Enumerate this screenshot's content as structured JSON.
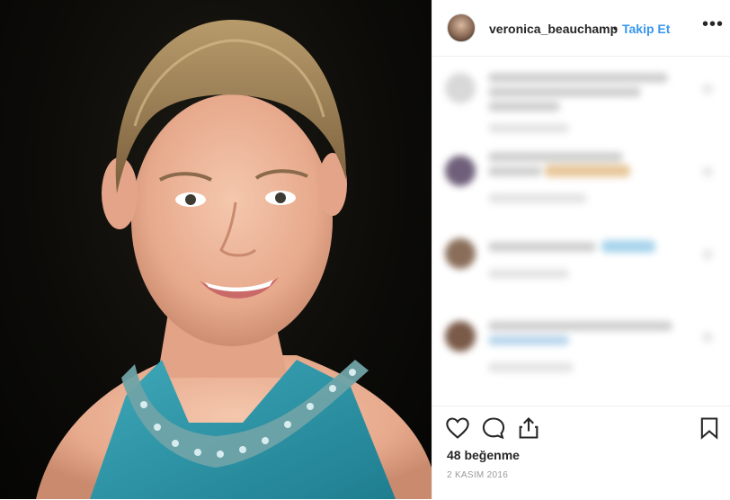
{
  "post": {
    "username": "veronica_beauchamp",
    "separator": "•",
    "follow_label": "Takip Et",
    "more_label": "•••",
    "likes_text": "48 beğenme",
    "date_text": "2 KASIM 2016"
  },
  "icons": {
    "like": "heart-icon",
    "comment": "comment-icon",
    "share": "share-icon",
    "save": "bookmark-icon"
  },
  "colors": {
    "link": "#3897f0",
    "text": "#262626",
    "muted": "#999999"
  }
}
